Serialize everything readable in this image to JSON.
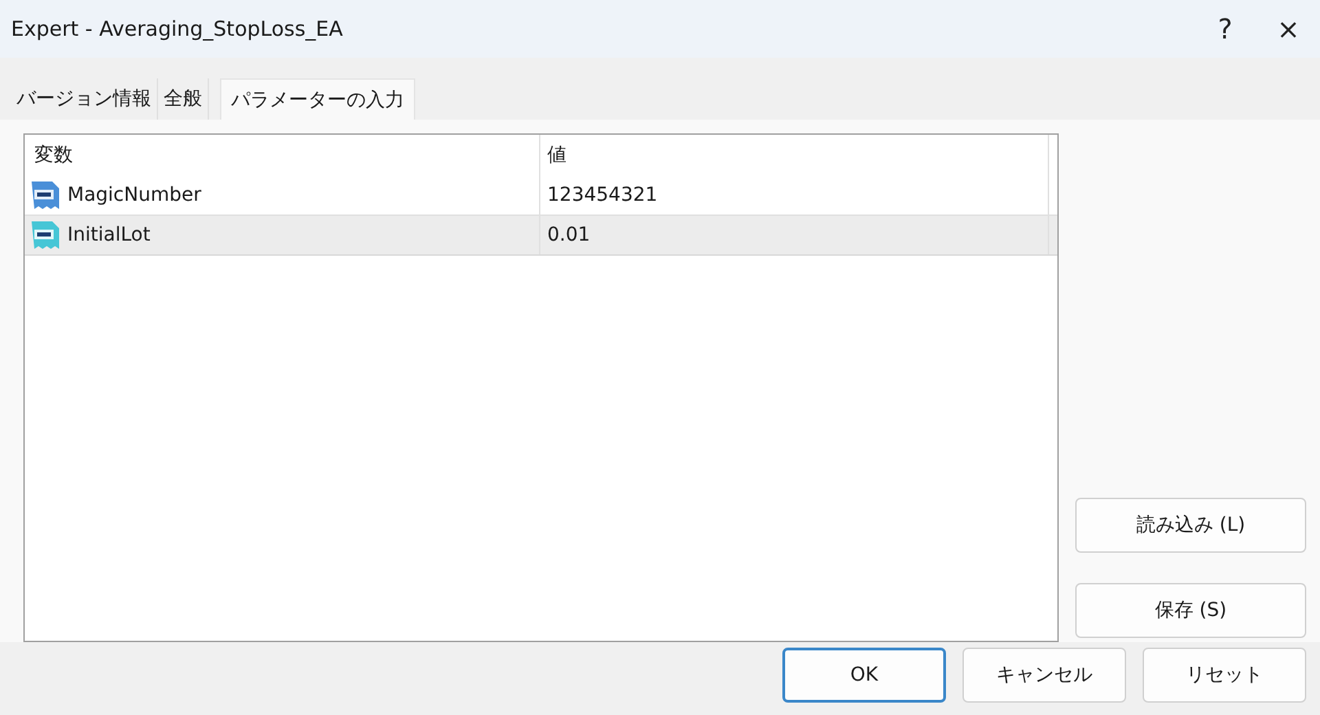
{
  "window": {
    "title": "Expert - Averaging_StopLoss_EA",
    "help": "?",
    "close": "×"
  },
  "tabs": [
    {
      "label": "バージョン情報",
      "selected": false
    },
    {
      "label": "全般",
      "selected": false
    },
    {
      "label": "パラメーターの入力",
      "selected": true
    }
  ],
  "table": {
    "columns": [
      "変数",
      "値"
    ],
    "rows": [
      {
        "kind": "integer",
        "name": "MagicNumber",
        "value": "123454321",
        "selected": false
      },
      {
        "kind": "double",
        "name": "InitialLot",
        "value": "0.01",
        "selected": true
      }
    ]
  },
  "side_buttons": [
    "読み込み (L)",
    "保存 (S)"
  ],
  "footer_buttons": [
    {
      "label": "OK",
      "default": true
    },
    {
      "label": "キャンセル",
      "default": false
    },
    {
      "label": "リセット",
      "default": false
    }
  ]
}
